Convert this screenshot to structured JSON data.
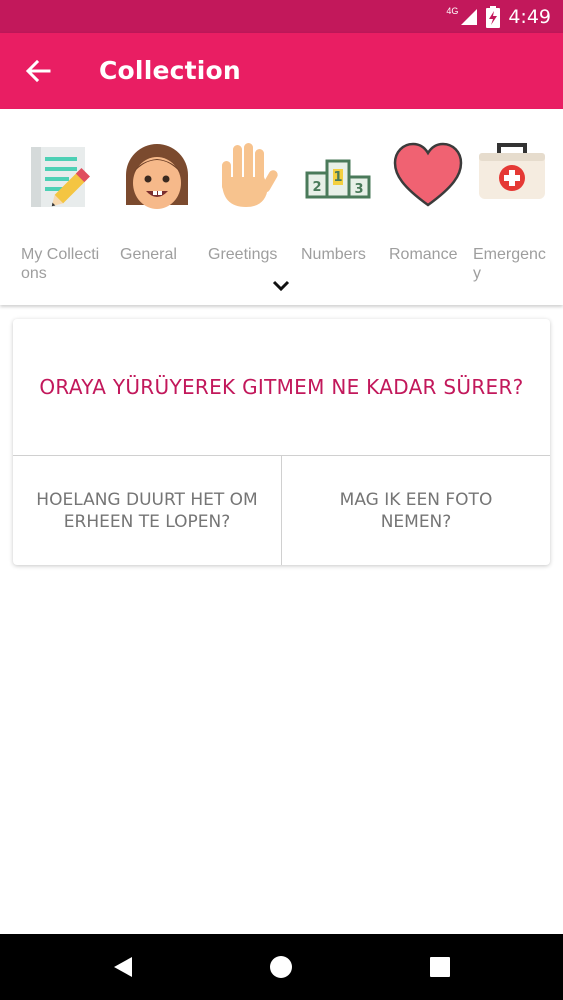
{
  "status_bar": {
    "time": "4:49",
    "network": "4G"
  },
  "app_bar": {
    "title": "Collection"
  },
  "categories": [
    {
      "label": "My Collections",
      "icon": "notebook-pencil-icon"
    },
    {
      "label": "General",
      "icon": "smiling-child-face-icon"
    },
    {
      "label": "Greetings",
      "icon": "waving-hand-icon"
    },
    {
      "label": "Numbers",
      "icon": "podium-icon"
    },
    {
      "label": "Romance",
      "icon": "heart-icon"
    },
    {
      "label": "Emergency",
      "icon": "first-aid-kit-icon"
    }
  ],
  "phrase_card": {
    "question": "ORAYA YÜRÜYEREK GITMEM NE KADAR SÜRER?",
    "answers": [
      "HOELANG DUURT HET OM ERHEEN TE LOPEN?",
      "MAG IK EEN FOTO NEMEN?"
    ]
  },
  "colors": {
    "primary": "#e91e63",
    "primary_dark": "#c2185b",
    "label_gray": "#9e9e9e",
    "answer_gray": "#757575"
  }
}
